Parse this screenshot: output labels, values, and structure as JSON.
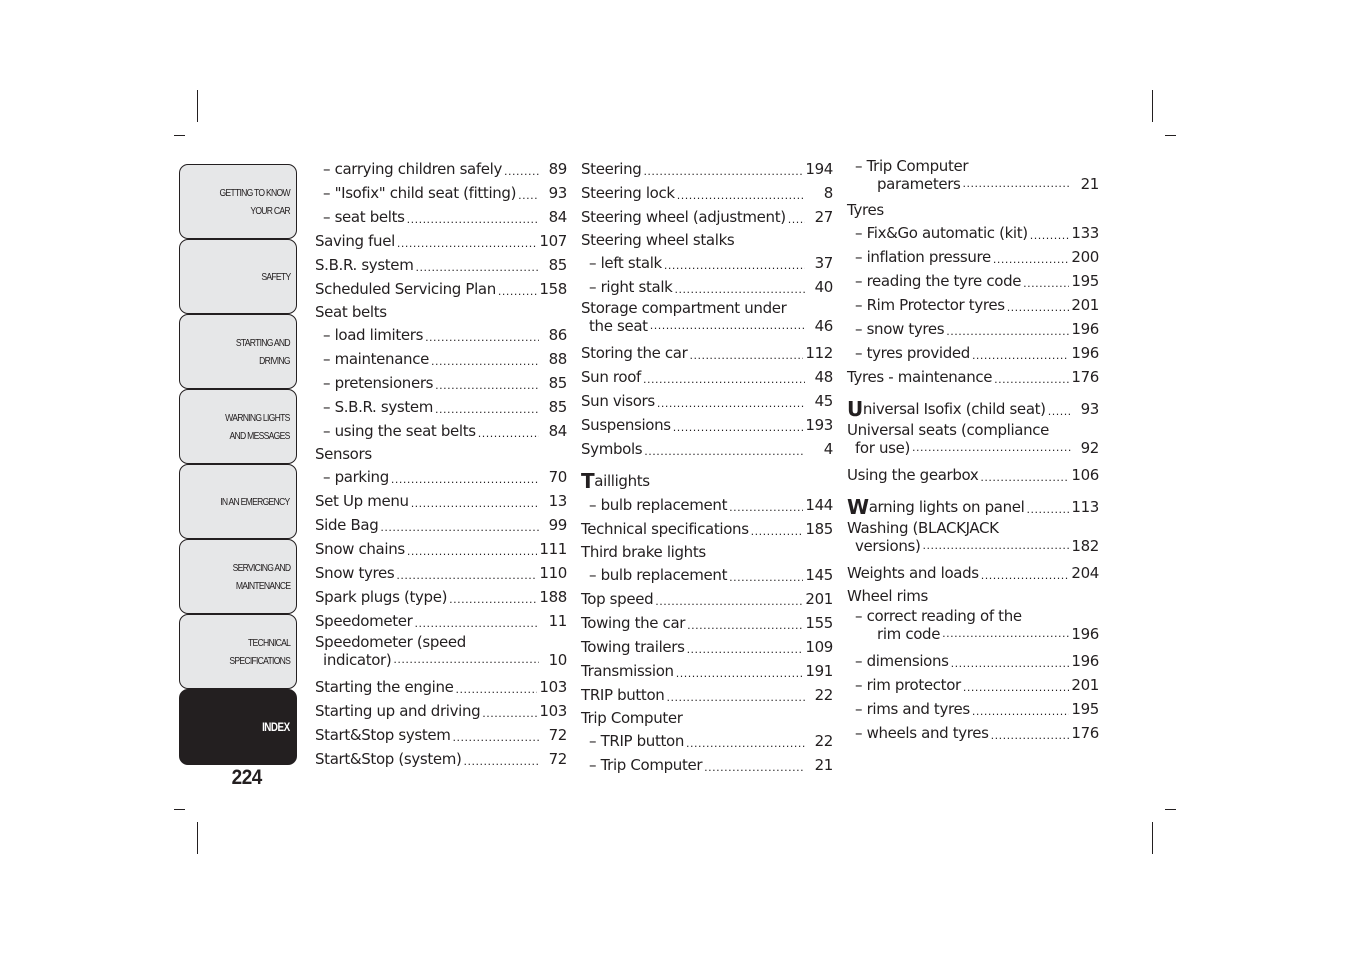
{
  "sidebar": {
    "tabs": [
      {
        "label": "GETTING TO KNOW\nYOUR CAR",
        "active": false
      },
      {
        "label": "SAFETY",
        "active": false
      },
      {
        "label": "STARTING AND\nDRIVING",
        "active": false
      },
      {
        "label": "WARNING LIGHTS\nAND MESSAGES",
        "active": false
      },
      {
        "label": "IN AN EMERGENCY",
        "active": false
      },
      {
        "label": "SERVICING AND\nMAINTENANCE",
        "active": false
      },
      {
        "label": "TECHNICAL\nSPECIFICATIONS",
        "active": false
      },
      {
        "label": "INDEX",
        "active": true
      }
    ],
    "page_number": "224"
  },
  "columns": [
    {
      "entries": [
        {
          "label": "– carrying children safely",
          "page": "89"
        },
        {
          "label": "– \"Isofix\" child seat (fitting)",
          "page": "93"
        },
        {
          "label": "– seat belts",
          "page": "84"
        },
        {
          "label": "Saving fuel",
          "page": "107"
        },
        {
          "label": "S.B.R. system",
          "page": "85"
        },
        {
          "label": "Scheduled Servicing Plan",
          "page": "158"
        },
        {
          "label": "Seat belts",
          "page": ""
        },
        {
          "label": "– load limiters",
          "page": "86"
        },
        {
          "label": "– maintenance",
          "page": "88"
        },
        {
          "label": "– pretensioners",
          "page": "85"
        },
        {
          "label": "– S.B.R. system",
          "page": "85"
        },
        {
          "label": "– using the seat belts",
          "page": "84"
        },
        {
          "label": "Sensors",
          "page": ""
        },
        {
          "label": "– parking",
          "page": "70"
        },
        {
          "label": "Set Up menu",
          "page": "13"
        },
        {
          "label": "Side Bag",
          "page": "99"
        },
        {
          "label": "Snow chains",
          "page": "111"
        },
        {
          "label": "Snow tyres",
          "page": "110"
        },
        {
          "label": "Spark plugs (type)",
          "page": "188"
        },
        {
          "label": "Speedometer",
          "page": "11"
        },
        {
          "label": "Speedometer (speed",
          "label2": "indicator)",
          "page": "10"
        },
        {
          "label": "Starting the engine",
          "page": "103"
        },
        {
          "label": "Starting up and driving",
          "page": "103"
        },
        {
          "label": "Start&Stop system",
          "page": "72"
        },
        {
          "label": "Start&Stop (system)",
          "page": "72"
        }
      ]
    },
    {
      "entries": [
        {
          "label": "Steering",
          "page": "194"
        },
        {
          "label": "Steering lock",
          "page": "8"
        },
        {
          "label": "Steering wheel (adjustment)",
          "page": "27"
        },
        {
          "label": "Steering wheel stalks",
          "page": ""
        },
        {
          "label": "– left stalk",
          "page": "37"
        },
        {
          "label": "– right stalk",
          "page": "40"
        },
        {
          "label": "Storage compartment under",
          "label2": "the seat",
          "page": "46"
        },
        {
          "label": "Storing the car",
          "page": "112"
        },
        {
          "label": "Sun roof",
          "page": "48"
        },
        {
          "label": "Sun visors",
          "page": "45"
        },
        {
          "label": "Suspensions",
          "page": "193"
        },
        {
          "label": "Symbols",
          "page": "4"
        },
        {
          "label": "Taillights",
          "page": "",
          "letter": "T"
        },
        {
          "label": "– bulb replacement",
          "page": "144"
        },
        {
          "label": "Technical specifications",
          "page": "185"
        },
        {
          "label": "Third brake lights",
          "page": ""
        },
        {
          "label": "– bulb replacement",
          "page": "145"
        },
        {
          "label": "Top speed",
          "page": "201"
        },
        {
          "label": "Towing the car",
          "page": "155"
        },
        {
          "label": "Towing trailers",
          "page": "109"
        },
        {
          "label": "Transmission",
          "page": "191"
        },
        {
          "label": "TRIP button",
          "page": "22"
        },
        {
          "label": "Trip Computer",
          "page": ""
        },
        {
          "label": "– TRIP button",
          "page": "22"
        },
        {
          "label": "– Trip Computer",
          "page": "21"
        }
      ]
    },
    {
      "entries": [
        {
          "label": "– Trip Computer",
          "label2": "parameters",
          "page": "21"
        },
        {
          "label": "Tyres",
          "page": ""
        },
        {
          "label": "– Fix&Go automatic (kit)",
          "page": "133"
        },
        {
          "label": "– inflation pressure",
          "page": "200"
        },
        {
          "label": "– reading the tyre code",
          "page": "195"
        },
        {
          "label": "– Rim Protector tyres",
          "page": "201"
        },
        {
          "label": "– snow tyres",
          "page": "196"
        },
        {
          "label": "– tyres provided",
          "page": "196"
        },
        {
          "label": "Tyres - maintenance",
          "page": "176"
        },
        {
          "label": "Universal Isofix (child seat)",
          "page": "93",
          "letter": "U"
        },
        {
          "label": "Universal seats (compliance",
          "label2": "for use)",
          "page": "92"
        },
        {
          "label": "Using the gearbox",
          "page": "106"
        },
        {
          "label": "Warning lights on panel",
          "page": "113",
          "letter": "W"
        },
        {
          "label": "Washing (BLACKJACK",
          "label2": "versions)",
          "page": "182"
        },
        {
          "label": "Weights and loads",
          "page": "204"
        },
        {
          "label": "Wheel rims",
          "page": ""
        },
        {
          "label": "– correct reading of the",
          "label2": "rim code",
          "page": "196"
        },
        {
          "label": "– dimensions",
          "page": "196"
        },
        {
          "label": "– rim protector",
          "page": "201"
        },
        {
          "label": "– rims and tyres",
          "page": "195"
        },
        {
          "label": "– wheels and tyres",
          "page": "176"
        }
      ]
    }
  ]
}
